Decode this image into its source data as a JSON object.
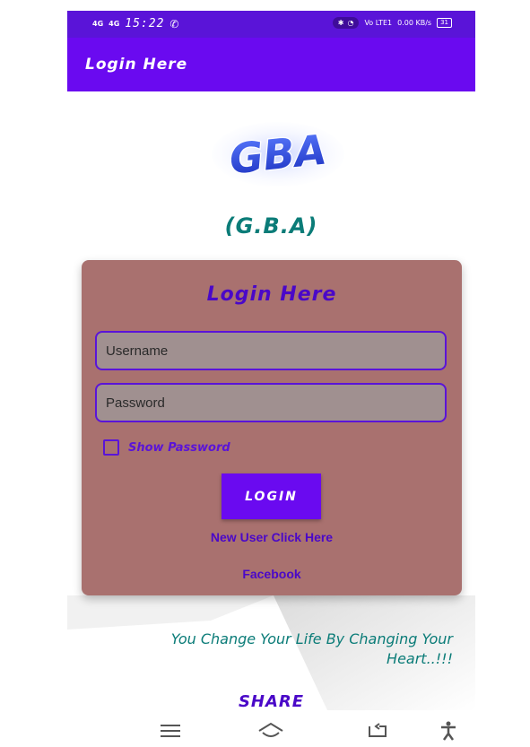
{
  "status_bar": {
    "network_1": "4G",
    "network_2": "4G",
    "time": "15:22",
    "volte": "Vo LTE1",
    "speed": "0.00 KB/s",
    "battery": "31"
  },
  "app_bar": {
    "title": "Login Here"
  },
  "logo": {
    "text": "GBA"
  },
  "subtitle": "(G.B.A)",
  "card": {
    "title": "Login Here",
    "username_placeholder": "Username",
    "password_placeholder": "Password",
    "show_password_label": "Show Password",
    "login_label": "LOGIN",
    "new_user_label": "New User Click Here",
    "facebook_label": "Facebook"
  },
  "quote": {
    "line1": "You Change Your Life By Changing Your",
    "line2": "Heart..!!!"
  },
  "share_label": "SHARE",
  "nav": {
    "menu_icon": "menu-icon",
    "home_icon": "home-icon",
    "back_icon": "back-icon",
    "accessibility_icon": "accessibility-icon"
  },
  "colors": {
    "status": "#5a14d8",
    "app_bar": "#6a0af0",
    "card": "#a9716f",
    "teal": "#0b7c78",
    "purple_text": "#4a08c8"
  }
}
